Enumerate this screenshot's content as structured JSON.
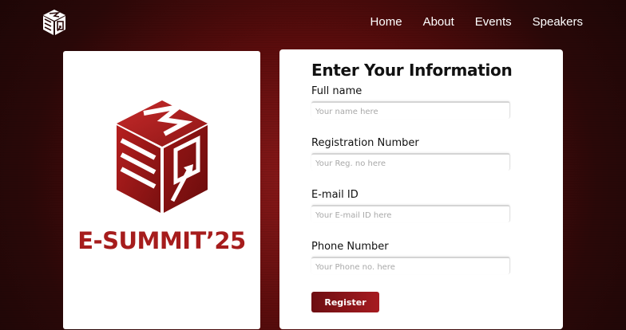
{
  "nav": {
    "logo_icon": "esummit-cube-logo-icon",
    "links": [
      "Home",
      "About",
      "Events",
      "Speakers"
    ]
  },
  "brand": {
    "logo_icon": "esummit-cube-logo-icon",
    "title": "E-SUMMIT’25",
    "title_color": "#a61c1c"
  },
  "form": {
    "title": "Enter Your Information",
    "fields": [
      {
        "label": "Full name",
        "placeholder": "Your name here",
        "value": ""
      },
      {
        "label": "Registration Number",
        "placeholder": "Your Reg. no here",
        "value": ""
      },
      {
        "label": "E-mail ID",
        "placeholder": "Your E-mail ID here",
        "value": ""
      },
      {
        "label": "Phone Number",
        "placeholder": "Your Phone no. here",
        "value": ""
      }
    ],
    "register_label": "Register"
  },
  "colors": {
    "accent": "#a61b20",
    "accent_dark": "#6d0e12",
    "background_center": "#8e1a1a",
    "background_edge": "#150505"
  }
}
